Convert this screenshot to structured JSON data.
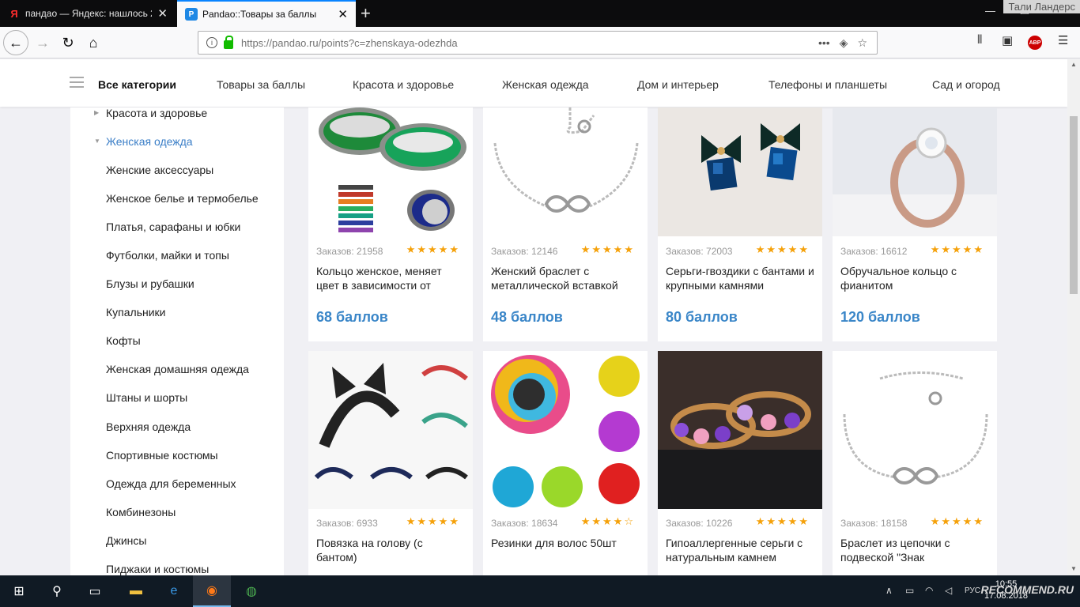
{
  "browser": {
    "tabs": [
      {
        "label": "пандао — Яндекс: нашлось 2",
        "favicon": "Я"
      },
      {
        "label": "Pandao::Товары за баллы",
        "favicon": "P"
      }
    ],
    "window_user": "Тали Ландерс",
    "url": "https://pandao.ru/points?c=zhenskaya-odezhda"
  },
  "header": {
    "all_categories": "Все категории",
    "nav": [
      "Товары за баллы",
      "Красота и здоровье",
      "Женская одежда",
      "Дом и интерьер",
      "Телефоны и планшеты",
      "Сад и огород"
    ]
  },
  "sidebar": {
    "parent": "Красота и здоровье",
    "active": "Женская одежда",
    "items": [
      "Женские аксессуары",
      "Женское белье и термобелье",
      "Платья, сарафаны и юбки",
      "Футболки, майки и топы",
      "Блузы и рубашки",
      "Купальники",
      "Кофты",
      "Женская домашняя одежда",
      "Штаны и шорты",
      "Верхняя одежда",
      "Спортивные костюмы",
      "Одежда для беременных",
      "Комбинезоны",
      "Джинсы",
      "Пиджаки и костюмы"
    ]
  },
  "products": [
    {
      "orders": "Заказов: 21958",
      "rating": 4.8,
      "name": "Кольцо женское, меняет цвет в зависимости от",
      "price": "68 баллов"
    },
    {
      "orders": "Заказов: 12146",
      "rating": 4.8,
      "name": "Женский браслет с металлической вставкой",
      "price": "48 баллов"
    },
    {
      "orders": "Заказов: 72003",
      "rating": 4.6,
      "name": "Серьги-гвоздики с бантами и крупными камнями",
      "price": "80 баллов"
    },
    {
      "orders": "Заказов: 16612",
      "rating": 4.6,
      "name": "Обручальное кольцо с фианитом",
      "price": "120 баллов"
    },
    {
      "orders": "Заказов: 6933",
      "rating": 4.8,
      "name": "Повязка на голову (с бантом)",
      "price": ""
    },
    {
      "orders": "Заказов: 18634",
      "rating": 4.4,
      "name": "Резинки для волос 50шт",
      "price": ""
    },
    {
      "orders": "Заказов: 10226",
      "rating": 4.6,
      "name": "Гипоаллергенные серьги с натуральным камнем",
      "price": ""
    },
    {
      "orders": "Заказов: 18158",
      "rating": 4.8,
      "name": "Браслет из цепочки с подвеской \"Знак",
      "price": ""
    }
  ],
  "taskbar": {
    "lang": "РУС",
    "time": "10:55",
    "date": "17.08.2018",
    "watermark": "RECOMMEND.RU"
  },
  "colors": {
    "accent": "#3a86c8",
    "star": "#f5a10a",
    "taskbar": "#101a24"
  }
}
